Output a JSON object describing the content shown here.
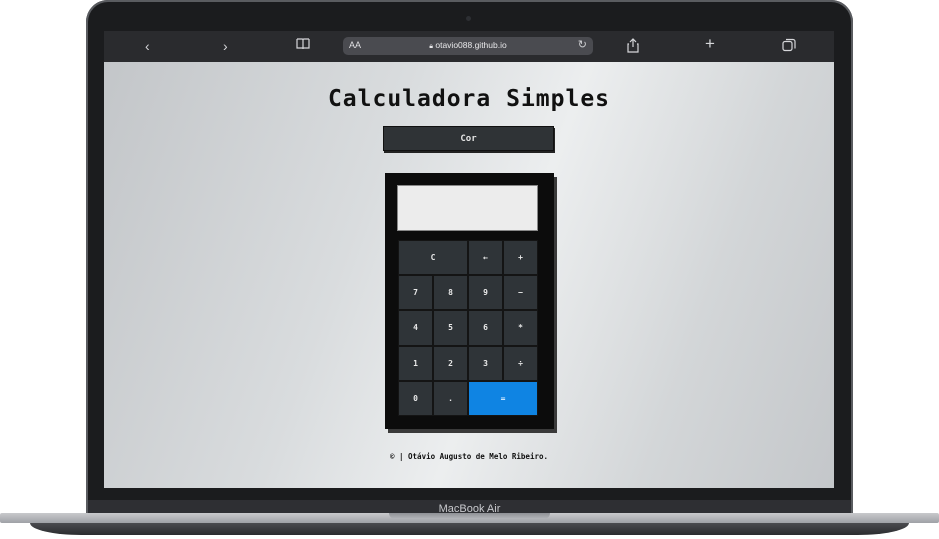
{
  "device": {
    "brand": "MacBook Air"
  },
  "browser": {
    "text_size_label": "AA",
    "url": "otavio088.github.io",
    "icons": [
      "back-icon",
      "forward-icon",
      "bookmarks-icon",
      "lock-icon",
      "reload-icon",
      "share-icon",
      "new-tab-icon",
      "tabs-icon"
    ],
    "glyphs": {
      "back": "‹",
      "forward": "›",
      "bookmarks": "📖",
      "lock": "🔒",
      "reload": "↻",
      "share": "⇪",
      "new_tab": "+",
      "tabs": "⧉"
    }
  },
  "page": {
    "title": "Calculadora Simples",
    "color_button": "Cor",
    "footer": "© | Otávio Augusto de Melo Ribeiro."
  },
  "calculator": {
    "display_value": "",
    "keys": {
      "clear": "C",
      "backspace": "←",
      "add": "+",
      "seven": "7",
      "eight": "8",
      "nine": "9",
      "subtract": "−",
      "four": "4",
      "five": "5",
      "six": "6",
      "multiply": "*",
      "one": "1",
      "two": "2",
      "three": "3",
      "divide": "÷",
      "zero": "0",
      "decimal": ".",
      "equals": "="
    }
  },
  "colors": {
    "equals_key": "#0f84e3",
    "key_bg": "#2f3438",
    "calc_body": "#0c0c0c"
  }
}
